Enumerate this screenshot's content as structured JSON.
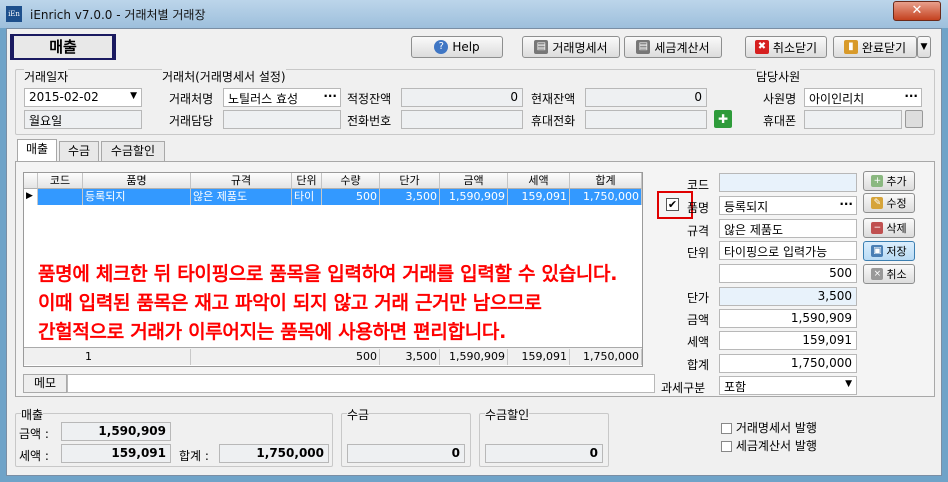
{
  "window": {
    "title": "iEnrich v7.0.0 - 거래처별 거래장",
    "close": "✕"
  },
  "toolbar": {
    "mode": "매출",
    "help": "Help",
    "statement": "거래명세서",
    "tax_invoice": "세금계산서",
    "cancel_close": "취소닫기",
    "done_close": "완료닫기"
  },
  "header": {
    "date_label": "거래일자",
    "date": "2015-02-02",
    "weekday": "월요일",
    "client_group": "거래처(거래명세서 설정)",
    "client_name_label": "거래처명",
    "client_name": "노틸러스 효성",
    "proper_balance_label": "적정잔액",
    "proper_balance": "0",
    "current_balance_label": "현재잔액",
    "current_balance": "0",
    "client_staff_label": "거래담당",
    "phone_label": "전화번호",
    "mobile_label": "휴대전화",
    "staff_group": "담당사원",
    "staff_name_label": "사원명",
    "staff_name": "아이인리치",
    "staff_mobile_label": "휴대폰"
  },
  "tabs": [
    "매출",
    "수금",
    "수금할인"
  ],
  "grid": {
    "columns": [
      "코드",
      "품명",
      "규격",
      "단위",
      "수량",
      "단가",
      "금액",
      "세액",
      "합계"
    ],
    "rows": [
      {
        "code": "",
        "name": "등록되지",
        "spec": "않은 제품도",
        "unit": "타이",
        "qty": "500",
        "price": "3,500",
        "amount": "1,590,909",
        "tax": "159,091",
        "total": "1,750,000"
      }
    ],
    "footer": {
      "count": "1",
      "qty": "500",
      "price": "3,500",
      "amount": "1,590,909",
      "tax": "159,091",
      "total": "1,750,000"
    }
  },
  "memo_label": "메모",
  "detail": {
    "code_label": "코드",
    "name_label": "품명",
    "name": "등록되지",
    "spec_label": "규격",
    "spec": "않은 제품도",
    "unit_label": "단위",
    "unit": "타이핑으로 입력가능",
    "qty": "500",
    "price_label": "단가",
    "price": "3,500",
    "amount_label": "금액",
    "amount": "1,590,909",
    "tax_label": "세액",
    "tax": "159,091",
    "total_label": "합계",
    "total": "1,750,000",
    "tax_type_label": "과세구분",
    "tax_type": "포함"
  },
  "side_buttons": {
    "add": "추가",
    "edit": "수정",
    "delete": "삭제",
    "save": "저장",
    "cancel": "취소"
  },
  "annotation": [
    "품명에 체크한 뒤 타이핑으로 품목을 입력하여 거래를 입력할 수 있습니다.",
    "이때 입력된 품목은 재고 파악이 되지 않고 거래 근거만 남으므로",
    "간헐적으로 거래가 이루어지는 품목에 사용하면 편리합니다."
  ],
  "summary": {
    "sales_title": "매출",
    "amount_label": "금액 :",
    "amount": "1,590,909",
    "tax_label": "세액 :",
    "tax": "159,091",
    "total_label": "합계 :",
    "total": "1,750,000",
    "collect_title": "수금",
    "collect_value": "0",
    "discount_title": "수금할인",
    "discount_value": "0",
    "issue_statement": "거래명세서 발행",
    "issue_invoice": "세금계산서 발행"
  },
  "colors": {
    "highlight": "#3399ff",
    "annotation": "#ff0000",
    "titlebar": "#9dbfdc"
  }
}
